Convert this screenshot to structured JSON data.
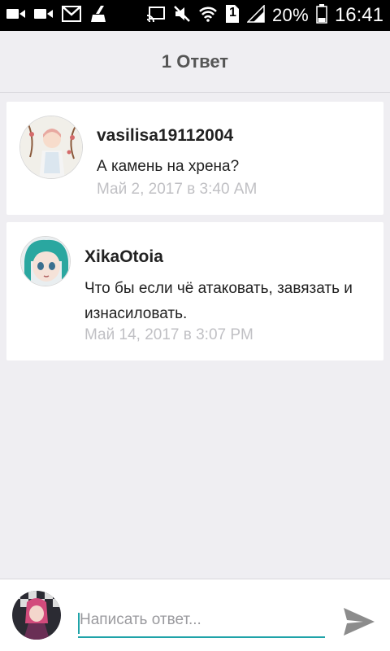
{
  "status_bar": {
    "battery_percent": "20%",
    "time": "16:41",
    "sim_badge": "1",
    "icons": [
      "video-icon",
      "video-icon",
      "gmail-icon",
      "cleaner-icon",
      "cast-icon",
      "mute-icon",
      "wifi-icon",
      "sim-icon",
      "signal-icon",
      "battery-icon"
    ]
  },
  "header": {
    "title": "1 Ответ"
  },
  "comments": [
    {
      "username": "vasilisa19112004",
      "message": "А камень на хрена?",
      "timestamp": "Май 2, 2017 в 3:40 AM"
    },
    {
      "username": "XikaOtoia",
      "message": "Что бы если чё атаковать, завязать и изнасиловать.",
      "timestamp": "Май 14, 2017 в 3:07 PM"
    }
  ],
  "composer": {
    "placeholder": "Написать ответ...",
    "value": "",
    "send_icon": "send-icon",
    "accent_color": "#1fa3a8"
  }
}
